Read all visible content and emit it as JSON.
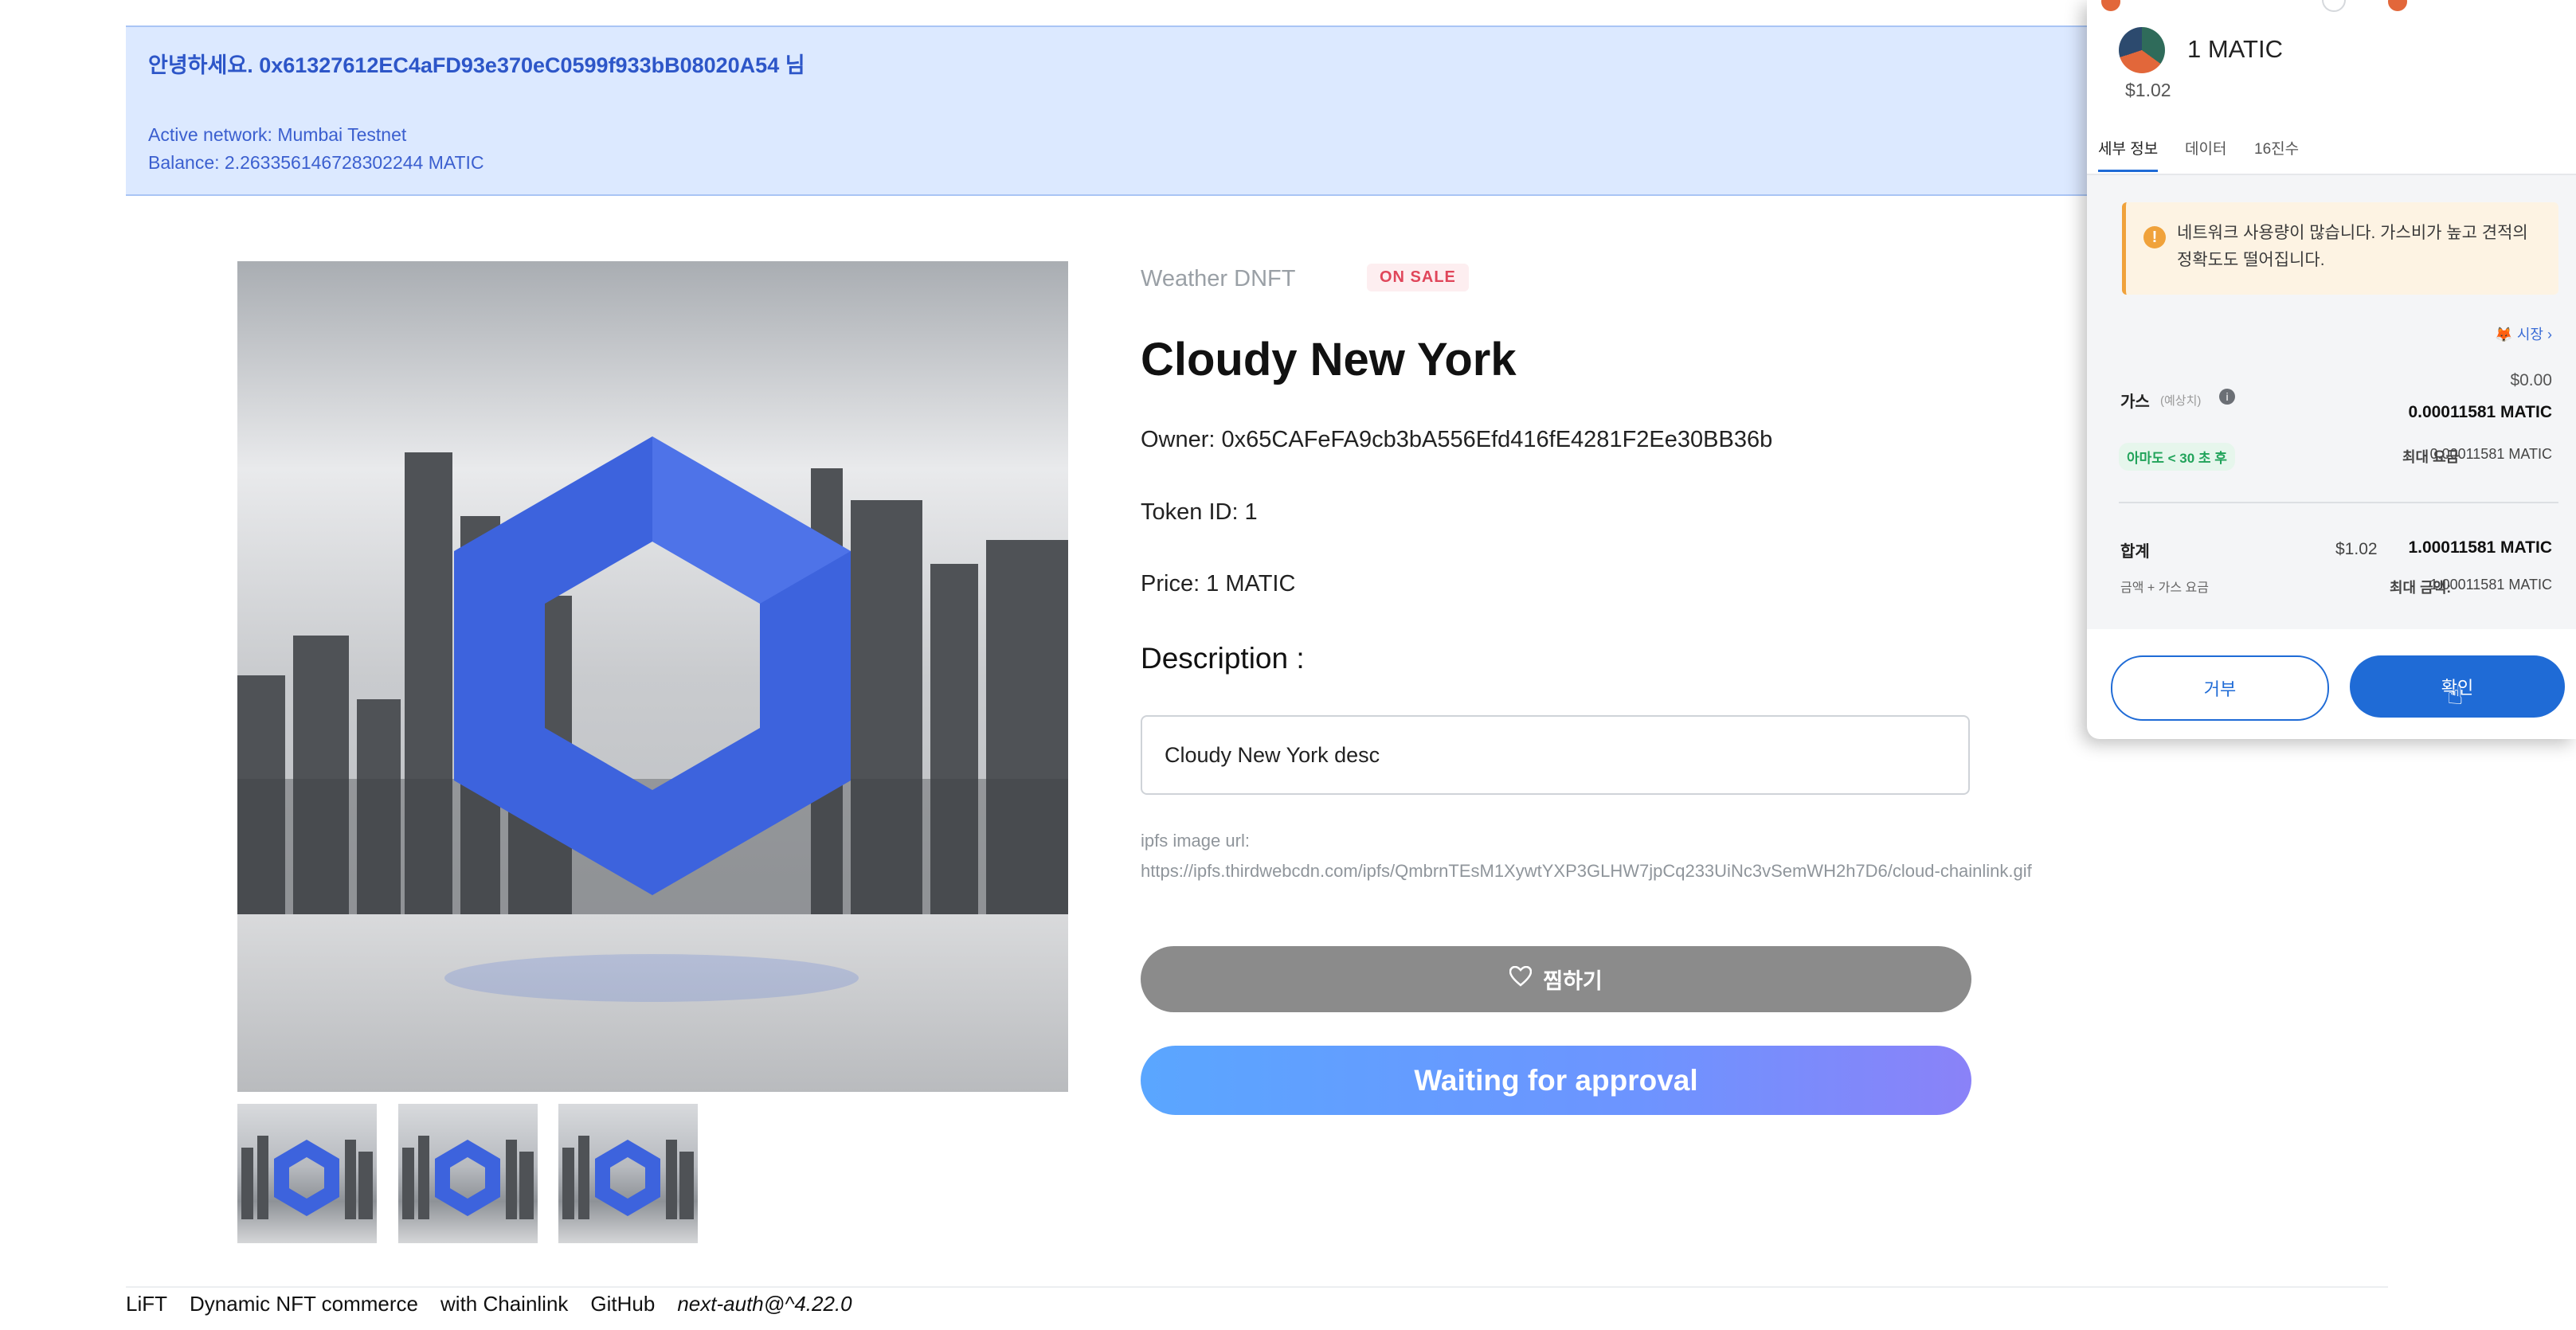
{
  "banner": {
    "greeting": "안녕하세요. 0x61327612EC4aFD93e370eC0599f933bB08020A54 님",
    "network": "Active network: Mumbai Testnet",
    "balance": "Balance: 2.263356146728302244 MATIC"
  },
  "nft": {
    "collection": "Weather DNFT",
    "badge": "ON SALE",
    "title": "Cloudy New York",
    "owner": "Owner: 0x65CAFeFA9cb3bA556Efd416fE4281F2Ee30BB36b",
    "token_id": "Token ID: 1",
    "price": "Price: 1 MATIC",
    "description_heading": "Description :",
    "description": "Cloudy New York desc",
    "ipfs_label": "ipfs image url:",
    "ipfs_url": "https://ipfs.thirdwebcdn.com/ipfs/QmbrnTEsM1XywtYXP3GLHW7jpCq233UiNc3vSemWH2h7D6/cloud-chainlink.gif",
    "like_label": "찜하기",
    "action_label": "Waiting for approval"
  },
  "footer": {
    "items": [
      "LiFT",
      "Dynamic NFT commerce",
      "with Chainlink",
      "GitHub"
    ],
    "version": "next-auth@^4.22.0"
  },
  "wallet": {
    "token_amount": "1 MATIC",
    "fiat_amount": "$1.02",
    "tabs": [
      "세부 정보",
      "데이터",
      "16진수"
    ],
    "warning": "네트워크 사용량이 많습니다. 가스비가 높고 견적의 정확도도 떨어집니다.",
    "market_label": "시장",
    "gas_label": "가스",
    "gas_estimate_tag": "(예상치)",
    "gas_fiat": "$0.00",
    "gas_amount": "0.00011581 MATIC",
    "speed_label": "아마도 < 30 초 후",
    "max_fee_label": "최대 요금",
    "max_fee_value": "0.00011581 MATIC",
    "total_label": "합계",
    "total_fiat": "$1.02",
    "total_amount": "1.00011581 MATIC",
    "total_sub_label": "금액 + 가스 요금",
    "max_amount_label": "최대 금액:",
    "max_amount_value": "1.00011581 MATIC",
    "reject_label": "거부",
    "confirm_label": "확인"
  },
  "colors": {
    "banner_bg": "#dce9ff",
    "hexagon": "#3d63dd",
    "action_button": "#6d94ff",
    "wallet_primary": "#1f6bd6"
  }
}
